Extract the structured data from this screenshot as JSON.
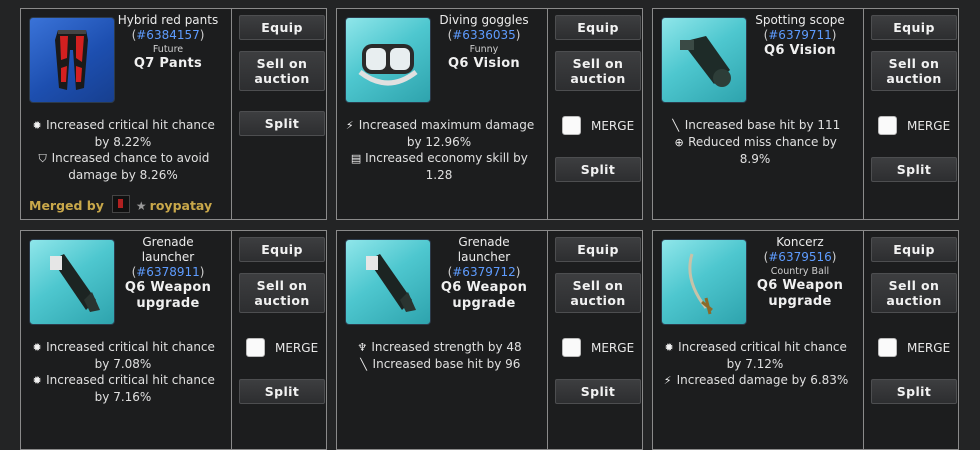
{
  "buttons": {
    "equip": "Equip",
    "sell": "Sell on auction",
    "split": "Split",
    "merge": "MERGE"
  },
  "items": [
    {
      "name": "Hybrid red pants",
      "id": "#6384157",
      "rarity": "Future",
      "class": "Q7 Pants",
      "image": "red-pants-icon",
      "stats": [
        {
          "icon": "crit-icon",
          "text": "Increased critical hit chance by 8.22%"
        },
        {
          "icon": "shield-icon",
          "text": "Increased chance to avoid damage by 8.26%"
        }
      ],
      "merged_label": "Merged by",
      "merged_user": "roypatay"
    },
    {
      "name": "Diving goggles",
      "id": "#6336035",
      "rarity": "Funny",
      "class": "Q6 Vision",
      "image": "goggles-icon",
      "stats": [
        {
          "icon": "damage-icon",
          "text": "Increased maximum damage by 12.96%"
        },
        {
          "icon": "economy-icon",
          "text": "Increased economy skill by 1.28"
        }
      ]
    },
    {
      "name": "Spotting scope",
      "id": "#6379711",
      "rarity": "",
      "class": "Q6 Vision",
      "image": "scope-icon",
      "stats": [
        {
          "icon": "sword-icon",
          "text": "Increased base hit by 111"
        },
        {
          "icon": "crosshair-icon",
          "text": "Reduced miss chance by 8.9%"
        }
      ]
    },
    {
      "name": "Grenade launcher",
      "id": "#6378911",
      "rarity": "",
      "class": "Q6 Weapon upgrade",
      "image": "grenade-launcher-icon",
      "stats": [
        {
          "icon": "crit-icon",
          "text": "Increased critical hit chance by 7.08%"
        },
        {
          "icon": "crit-icon",
          "text": "Increased critical hit chance by 7.16%"
        }
      ]
    },
    {
      "name": "Grenade launcher",
      "id": "#6379712",
      "rarity": "",
      "class": "Q6 Weapon upgrade",
      "image": "grenade-launcher-icon",
      "stats": [
        {
          "icon": "strength-icon",
          "text": "Increased strength by 48"
        },
        {
          "icon": "sword-icon",
          "text": "Increased base hit by 96"
        }
      ]
    },
    {
      "name": "Koncerz",
      "id": "#6379516",
      "rarity": "Country Ball",
      "class": "Q6 Weapon upgrade",
      "image": "sabre-icon",
      "stats": [
        {
          "icon": "crit-icon",
          "text": "Increased critical hit chance by 7.12%"
        },
        {
          "icon": "damage-icon",
          "text": "Increased damage by 6.83%"
        }
      ]
    }
  ]
}
